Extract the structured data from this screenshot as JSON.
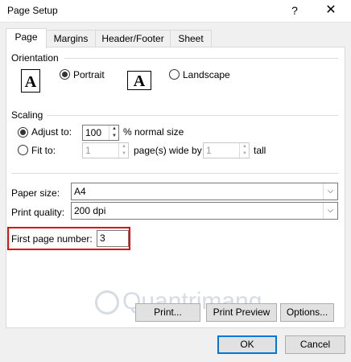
{
  "window": {
    "title": "Page Setup",
    "help_label": "?",
    "close_label": "✕"
  },
  "tabs": [
    {
      "label": "Page",
      "active": true
    },
    {
      "label": "Margins",
      "active": false
    },
    {
      "label": "Header/Footer",
      "active": false
    },
    {
      "label": "Sheet",
      "active": false
    }
  ],
  "orientation": {
    "section_label": "Orientation",
    "icon_glyph": "A",
    "portrait_label": "Portrait",
    "landscape_label": "Landscape",
    "selected": "Portrait"
  },
  "scaling": {
    "section_label": "Scaling",
    "adjust_label": "Adjust to:",
    "adjust_value": "100",
    "adjust_suffix": "% normal size",
    "fit_label": "Fit to:",
    "fit_wide_value": "1",
    "fit_wide_suffix": "page(s) wide by",
    "fit_tall_value": "1",
    "fit_tall_suffix": "tall",
    "selected": "Adjust to"
  },
  "paper_size": {
    "label": "Paper size:",
    "value": "A4"
  },
  "print_quality": {
    "label": "Print quality:",
    "value": "200 dpi"
  },
  "first_page_number": {
    "label": "First page number:",
    "value": "3"
  },
  "buttons": {
    "print": "Print...",
    "print_preview": "Print Preview",
    "options": "Options...",
    "ok": "OK",
    "cancel": "Cancel"
  },
  "watermark": {
    "text": "Quantrimang"
  },
  "colors": {
    "highlight": "#e01010",
    "accent": "#0078d7"
  },
  "icons": {
    "spin_up": "▲",
    "spin_down": "▼",
    "dropdown": "⌵"
  }
}
